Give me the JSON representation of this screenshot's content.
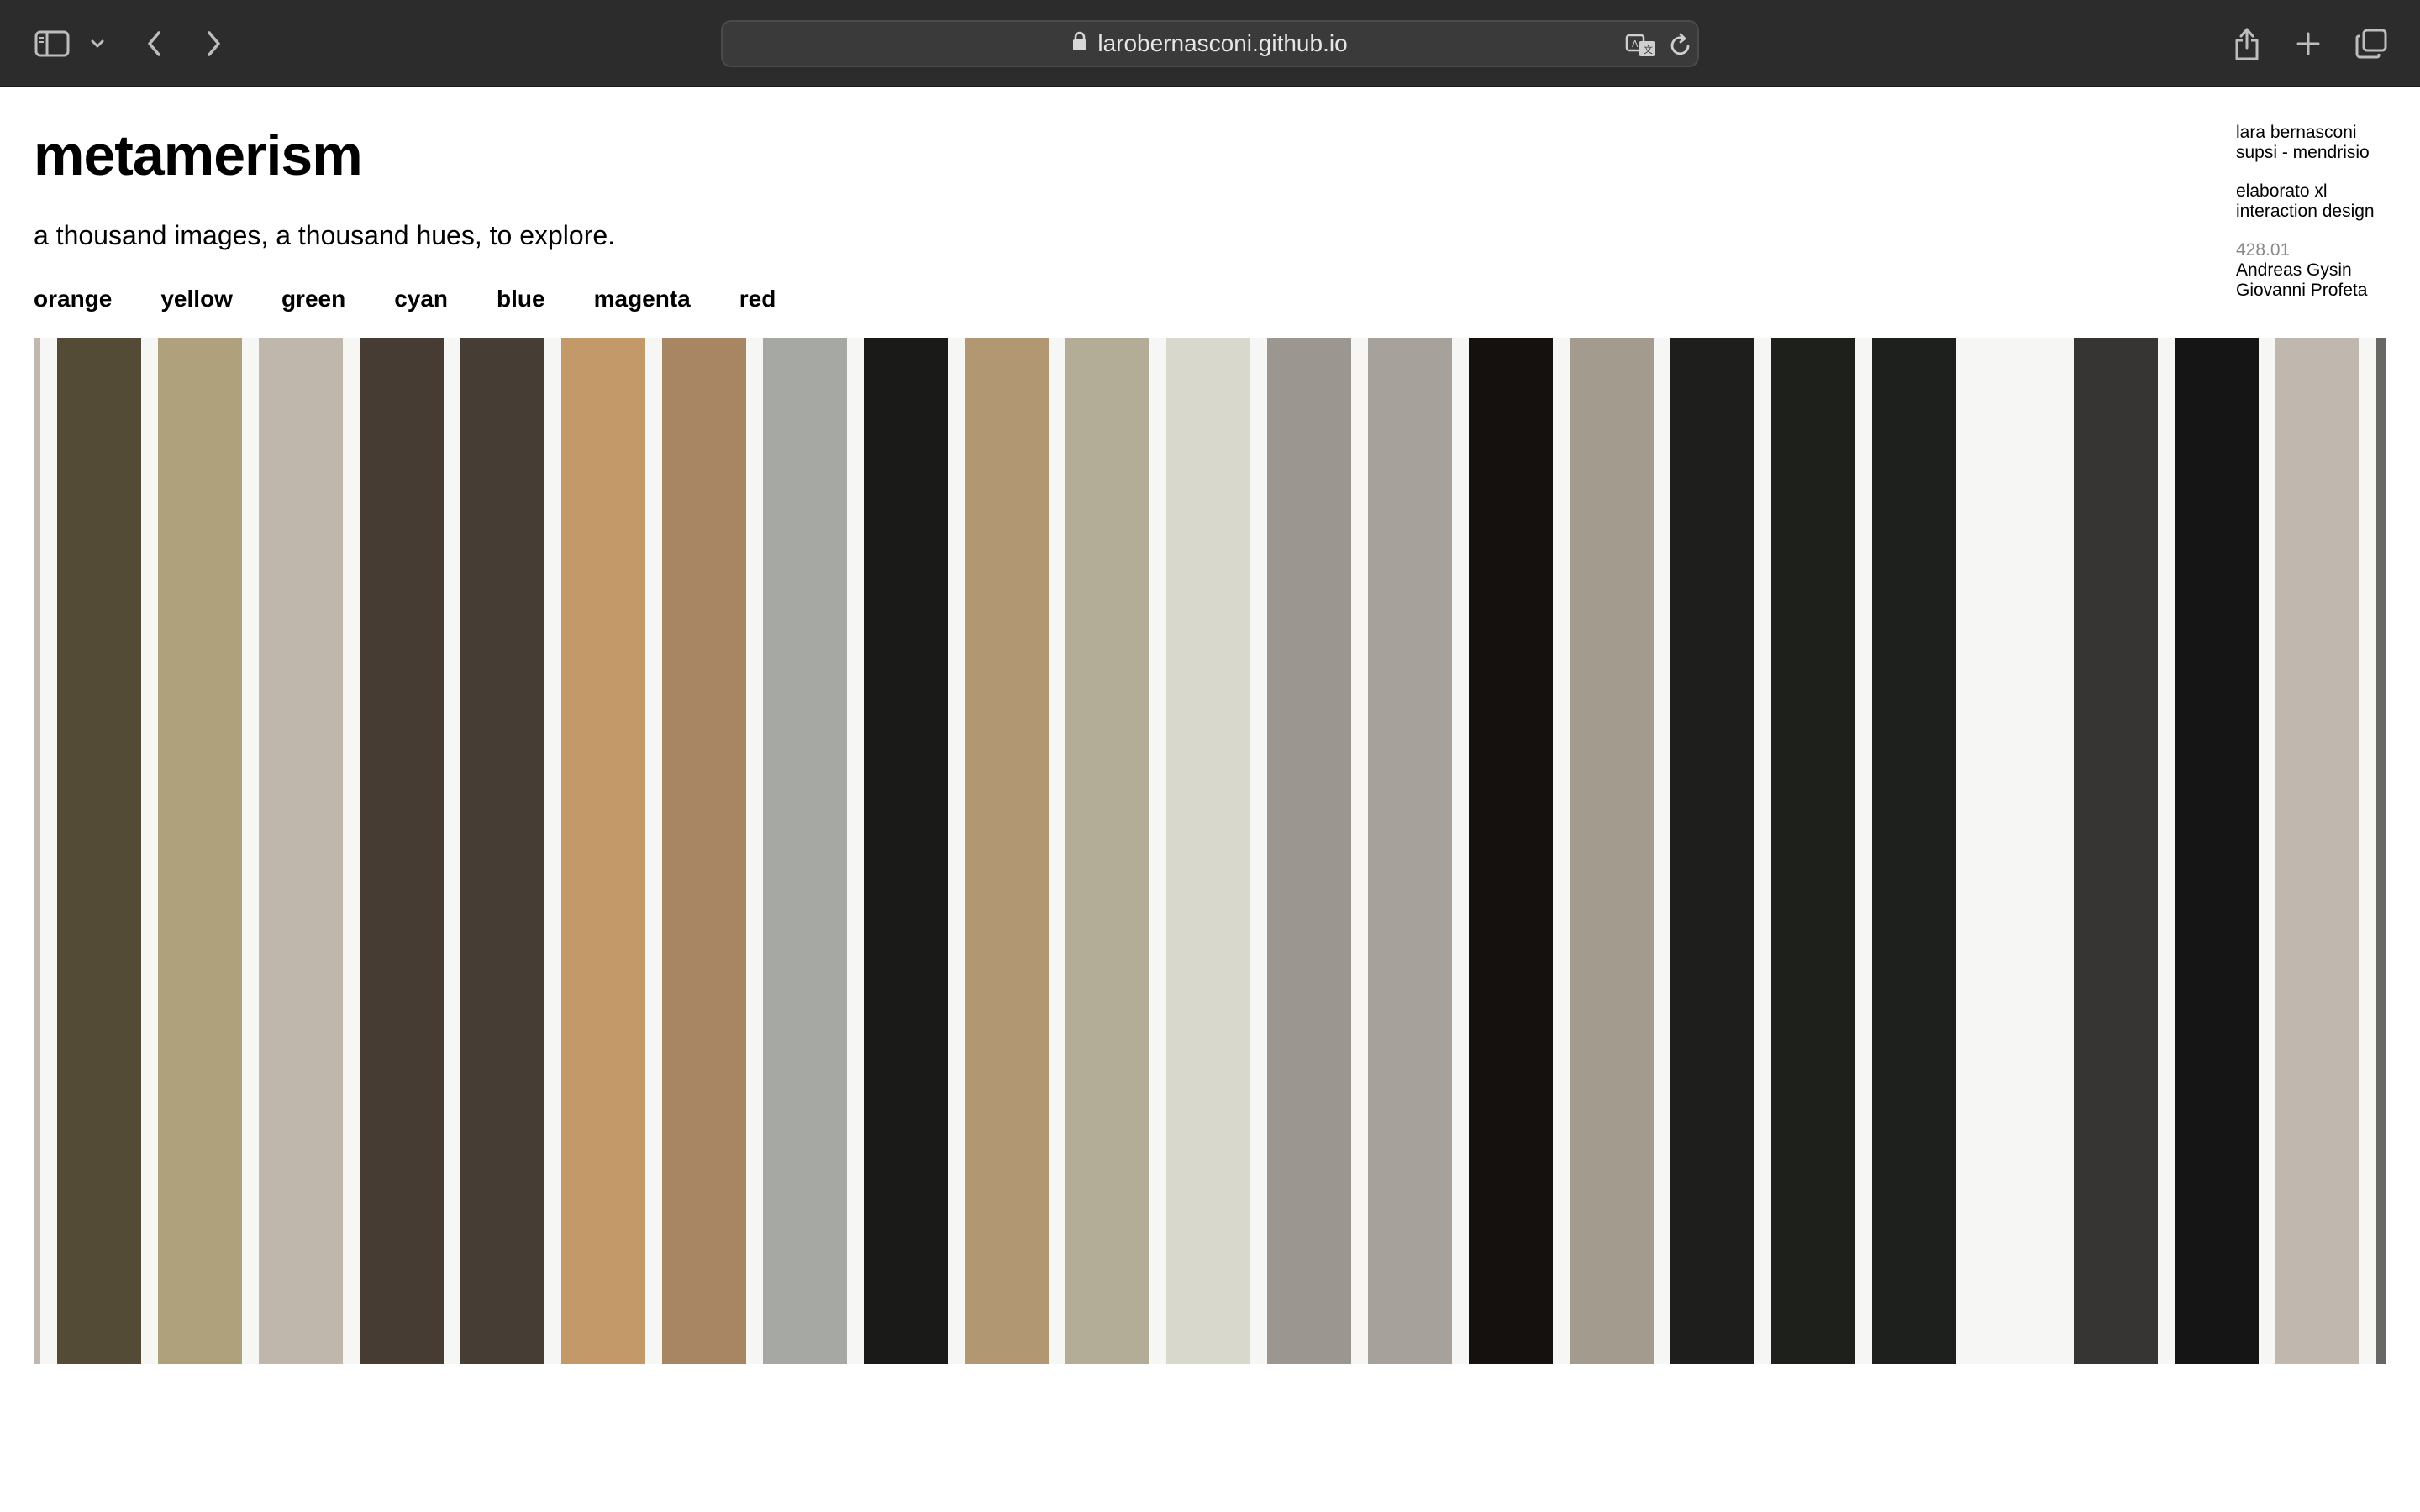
{
  "browser": {
    "url": "larobernasconi.github.io",
    "icons": {
      "sidebar": "sidebar-icon",
      "sidebar_menu": "chevron-down-icon",
      "back": "chevron-left-icon",
      "forward": "chevron-right-icon",
      "lock": "lock-icon",
      "translate": "translate-icon",
      "reload": "reload-icon",
      "share": "share-icon",
      "new_tab": "plus-icon",
      "tabs": "tab-overview-icon"
    }
  },
  "page": {
    "title": "metamerism",
    "subtitle": "a thousand images, a thousand hues, to explore.",
    "filters": [
      "orange",
      "yellow",
      "green",
      "cyan",
      "blue",
      "magenta",
      "red"
    ],
    "credits": {
      "author": "lara bernasconi",
      "school": "supsi - mendrisio",
      "project": "elaborato xl",
      "discipline": "interaction design",
      "course_no": "428.01",
      "teacher_1": "Andreas Gysin",
      "teacher_2": "Giovanni Profeta"
    }
  },
  "stripes": [
    "#c0b8ae",
    "#534b35",
    "#b0a17d",
    "#bfb7ac",
    "#463c33",
    "#463d34",
    "#c39969",
    "#a98663",
    "#a6a8a3",
    "#1a1a19",
    "#b29872",
    "#b3ac97",
    "#d9d8cd",
    "#9b968f",
    "#a6a19a",
    "#14110f",
    "#a39b8e",
    "#1e1f1d",
    "#1e201c",
    "#1e201d",
    "#f6f6f5",
    "#363533",
    "#151515",
    "#c0b8ae",
    "#676763"
  ]
}
